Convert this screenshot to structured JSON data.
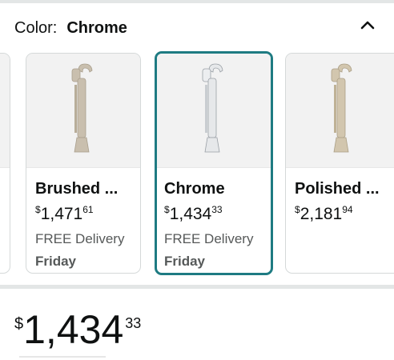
{
  "color_selector": {
    "label": "Color:",
    "value": "Chrome",
    "collapse_icon": "chevron-up-icon"
  },
  "variants": [
    {
      "name": "Brushed ...",
      "price_symbol": "$",
      "price_whole": "1,471",
      "price_fraction": "61",
      "delivery": "FREE Delivery",
      "day": "Friday",
      "finish_color": "#c9bfae",
      "selected": false
    },
    {
      "name": "Chrome",
      "price_symbol": "$",
      "price_whole": "1,434",
      "price_fraction": "33",
      "delivery": "FREE Delivery",
      "day": "Friday",
      "finish_color": "#e6e8ea",
      "selected": true
    },
    {
      "name": "Polished ...",
      "price_symbol": "$",
      "price_whole": "2,181",
      "price_fraction": "94",
      "delivery": "",
      "day": "",
      "finish_color": "#d2c6ae",
      "selected": false
    }
  ],
  "selected_price": {
    "symbol": "$",
    "whole": "1,434",
    "fraction": "33"
  },
  "colors": {
    "selected_border": "#1e7b82",
    "card_border": "#d5d9d9",
    "image_background": "#f2f2f2",
    "muted_text": "#565959"
  }
}
